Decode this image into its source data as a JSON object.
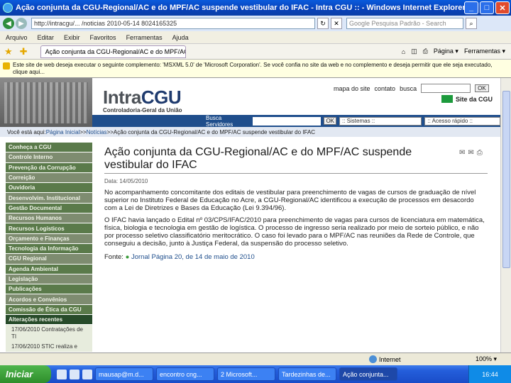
{
  "window": {
    "title": "Ação conjunta da CGU-Regional/AC e do MPF/AC suspende vestibular do IFAC - Intra CGU :: - Windows Internet Explorer",
    "minimize": "_",
    "maximize": "□",
    "close": "✕"
  },
  "address": {
    "url": "http://intracgu/... /noticias 2010-05-14 8024165325",
    "search_placeholder": "Google Pesquisa Padrão - Search"
  },
  "menu": [
    "Arquivo",
    "Editar",
    "Exibir",
    "Favoritos",
    "Ferramentas",
    "Ajuda"
  ],
  "favbar": {
    "tab_label": "Ação conjunta da CGU-Regional/AC e do MPF/AC sus...",
    "tools": [
      "Página ▾",
      "Ferramentas ▾"
    ]
  },
  "infobar": {
    "text": "Este site de web deseja executar o seguinte complemento: 'MSXML 5.0' de 'Microsoft Corporation'. Se você confia no site da web e no complemento e deseja permitir que ele seja executado, clique aqui..."
  },
  "site": {
    "logo_main": "Intra",
    "logo_accent": "CGU",
    "logo_sub": "Controladoria-Geral da União",
    "top_links": [
      "mapa do site",
      "contato",
      "busca"
    ],
    "ok_label": "OK",
    "site_uniao": "Site da CGU",
    "busca_servidores": "Busca Servidores",
    "sistemas": ":: Sistemas ::",
    "acesso_rapido": ":: Acesso rápido ::",
    "breadcrumb_prefix": "Você está aqui: ",
    "breadcrumb_home": "Página Inicial",
    "breadcrumb_news": "Notícias",
    "breadcrumb_current": "Ação conjunta da CGU-Regional/AC e do MPF/AC suspende vestibular do IFAC",
    "breadcrumb_sep": " >> "
  },
  "sidebar": {
    "items": [
      "Conheça a CGU",
      "Controle Interno",
      "Prevenção da Corrupção",
      "Correição",
      "Ouvidoria",
      "Desenvolvim. Institucional",
      "Gestão Documental",
      "Recursos Humanos",
      "Recursos Logísticos",
      "Orçamento e Finanças",
      "Tecnologia da Informação",
      "CGU Regional",
      "Agenda Ambiental",
      "Legislação",
      "Publicações",
      "Acordos e Convênios",
      "Comissão de Ética da CGU",
      "Alterações recentes"
    ],
    "recent": [
      "17/06/2010 Contratações de TI",
      "17/06/2010 STIC realiza e"
    ]
  },
  "article": {
    "title": "Ação conjunta da CGU-Regional/AC e do MPF/AC suspende vestibular do IFAC",
    "date": "Data: 14/05/2010",
    "p1": "No acompanhamento concomitante dos editais de vestibular para preenchimento de vagas de cursos de graduação de nível superior no Instituto Federal de Educação no Acre, a CGU-Regional/AC identificou a execução de processos em desacordo com a Lei de Diretrizes e Bases da Educação (Lei 9.394/96).",
    "p2": "O IFAC havia lançado o Edital nº 03/CPS/IFAC/2010 para preenchimento de vagas para cursos de licenciatura em matemática, física, biologia e tecnologia em gestão de logística. O processo de ingresso seria realizado por meio de sorteio público, e não por processo seletivo classificatório meritocrático. O caso foi levado para o MPF/AC nas reuniões da Rede de Controle, que conseguiu a decisão, junto à Justiça Federal, da suspensão do processo seletivo.",
    "fonte_label": "Fonte: ",
    "fonte_link": "Jornal Página 20, de 14 de maio de 2010"
  },
  "status": {
    "zone": "Internet",
    "zoom": "100% ▾"
  },
  "taskbar": {
    "start": "Iniciar",
    "tasks": [
      "mausap@m.d...",
      "encontro cng...",
      "2 Microsoft...",
      "Tardezinhas de...",
      "Ação conjunta..."
    ],
    "clock": "16:44"
  }
}
